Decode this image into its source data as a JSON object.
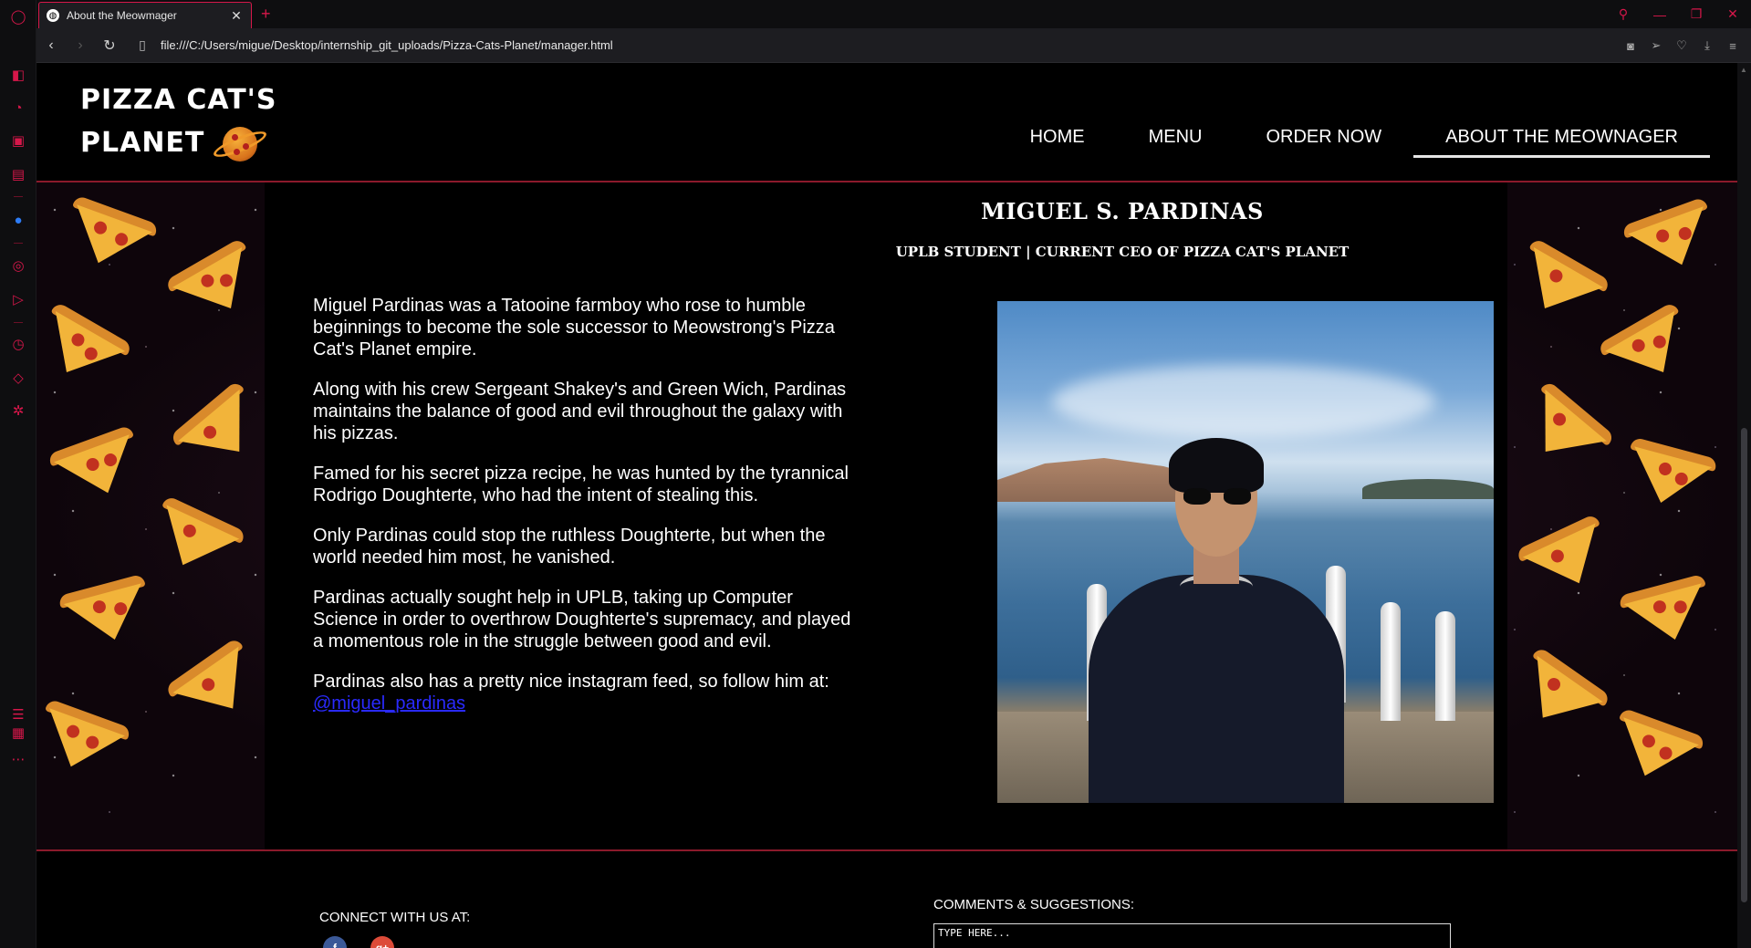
{
  "browser": {
    "tab_title": "About the Meowmager",
    "url": "file:///C:/Users/migue/Desktop/internship_git_uploads/Pizza-Cats-Planet/manager.html"
  },
  "site": {
    "logo_line1": "PIZZA CAT'S",
    "logo_line2": "PLANET",
    "nav": [
      {
        "label": "HOME"
      },
      {
        "label": "MENU"
      },
      {
        "label": "ORDER NOW"
      },
      {
        "label": "ABOUT THE MEOWNAGER",
        "active": true
      }
    ]
  },
  "profile": {
    "name": "MIGUEL S. PARDINAS",
    "subtitle": "UPLB STUDENT | CURRENT CEO OF PIZZA CAT'S PLANET",
    "paragraphs": [
      "Miguel Pardinas was a Tatooine farmboy who rose to humble beginnings to become the sole successor to Meowstrong's Pizza Cat's Planet empire.",
      "Along with his crew Sergeant Shakey's and Green Wich, Pardinas maintains the balance of good and evil throughout the galaxy with his pizzas.",
      "Famed for his secret pizza recipe, he was hunted by the tyrannical Rodrigo Doughterte, who had the intent of stealing this.",
      "Only Pardinas could stop the ruthless Doughterte, but when the world needed him most, he vanished.",
      "Pardinas actually sought help in UPLB, taking up Computer Science in order to overthrow Doughterte's supremacy, and played a momentous role in the struggle between good and evil.",
      "Pardinas also has a pretty nice instagram feed, so follow him at:"
    ],
    "instagram_handle": "@miguel_pardinas"
  },
  "footer": {
    "connect_label": "CONNECT WITH US AT:",
    "comments_label": "COMMENTS & SUGGESTIONS:",
    "comment_placeholder": "TYPE HERE..."
  },
  "colors": {
    "accent": "#d6174a",
    "divider": "#8b1a2b",
    "link": "#2a2aff"
  }
}
